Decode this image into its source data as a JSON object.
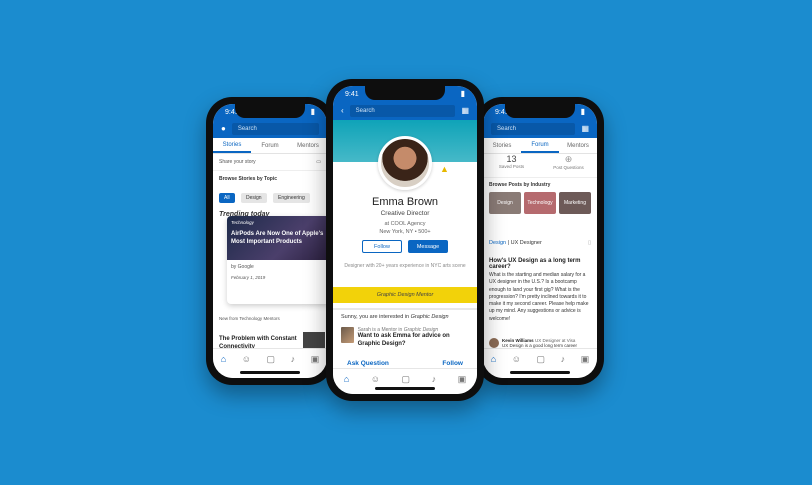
{
  "status_time": "9:41",
  "search_placeholder": "Search",
  "left": {
    "tabs": [
      "Stories",
      "Forum",
      "Mentors"
    ],
    "share_prompt": "Share your story",
    "browse_title": "Browse Stories by Topic",
    "filters": [
      "All",
      "Design",
      "Engineering"
    ],
    "trending_title": "Trending today",
    "story_tag": "Technology",
    "story_title": "AirPods Are Now One of Apple's Most Important Products",
    "story_source": "by Google",
    "story_date": "February 1, 2019",
    "section_title": "New from Technology Mentors",
    "article_title": "The Problem with Constant Connectivity"
  },
  "center": {
    "name": "Emma Brown",
    "role": "Creative Director",
    "company": "at COOL Agency",
    "location": "New York, NY",
    "connections": "500+",
    "follow_label": "Follow",
    "message_label": "Message",
    "experience": "Designer with 20+ years experience in NYC arts scene",
    "mentor_badge": "Graphic Design Mentor",
    "interest_prefix": "Sunny, you are interested in",
    "interest_topic": "Graphic Design",
    "mentor_note_prefix": "Sarah is a Mentor in",
    "mentor_note_topic": "Graphic Design",
    "question": "Want to ask Emma for advice on Graphic Design?",
    "ask_label": "Ask Question",
    "follow_action": "Follow"
  },
  "right": {
    "tabs": [
      "Stories",
      "Forum",
      "Mentors"
    ],
    "saved_count": "13",
    "saved_label": "Saved Posts",
    "post_label": "Post Questions",
    "browse_title": "Browse Posts by Industry",
    "industries": [
      "Design",
      "Technology",
      "Marketing"
    ],
    "post_tag": "Design",
    "post_role": "UX Designer",
    "post_title": "How's UX Design as a long term career?",
    "post_body": "What is the starting and median salary for a UX designer in the U.S.? Is a bootcamp enough to land your first gig? What is the progression? I'm pretty inclined towards it to make it my second career. Please help make up my mind. Any suggestions or advice is welcome!",
    "reply_name": "Kevin Williams",
    "reply_role": "UX Designer at Visa",
    "reply_text": "UX Design is a good long term career choice"
  },
  "colors": {
    "brand": "#0a66c2",
    "background": "#1b8ccf",
    "mentor": "#f2d20a"
  }
}
